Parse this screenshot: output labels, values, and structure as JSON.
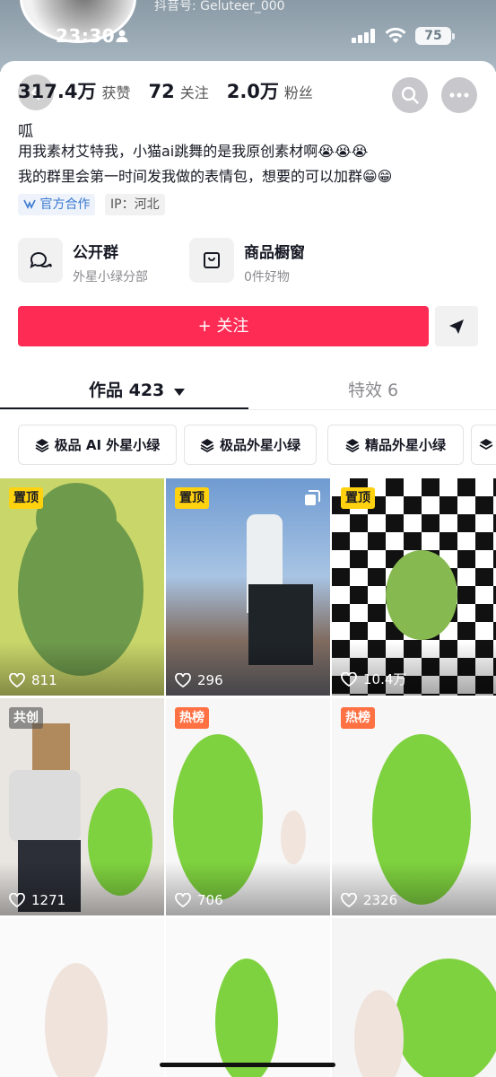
{
  "status_bar": {
    "time": "23:30",
    "battery": "75"
  },
  "header": {
    "douyin_id": "抖音号: Geluteer_000"
  },
  "stats": [
    {
      "num": "317.4万",
      "label": "获赞"
    },
    {
      "num": "72",
      "label": "关注"
    },
    {
      "num": "2.0万",
      "label": "粉丝"
    }
  ],
  "profile": {
    "name": "呱",
    "bio_line1": "用我素材艾特我，小猫ai跳舞的是我原创素材啊😭😭😭",
    "bio_line2": "我的群里会第一时间发我做的表情包，想要的可以加群😁😁",
    "tag_official": "官方合作",
    "tag_ip": "IP：河北"
  },
  "features": [
    {
      "title": "公开群",
      "sub": "外星小绿分部"
    },
    {
      "title": "商品橱窗",
      "sub": "0件好物"
    }
  ],
  "actions": {
    "follow": "+ 关注"
  },
  "tabs": {
    "works": "作品 423",
    "effects": "特效 6"
  },
  "chips": [
    "极品 AI 外星小绿",
    "极品外星小绿",
    "精品外星小绿"
  ],
  "videos": [
    {
      "badge": "置顶",
      "likes": "811"
    },
    {
      "badge": "置顶",
      "likes": "296"
    },
    {
      "badge": "置顶",
      "likes": "10.4万"
    },
    {
      "badge": "共创",
      "likes": "1271"
    },
    {
      "badge": "热榜",
      "likes": "706"
    },
    {
      "badge": "热榜",
      "likes": "2326"
    }
  ],
  "colors": {
    "accent": "#fe2c55",
    "pin_badge": "#ffd20f",
    "hot_badge": "#ff7043"
  }
}
